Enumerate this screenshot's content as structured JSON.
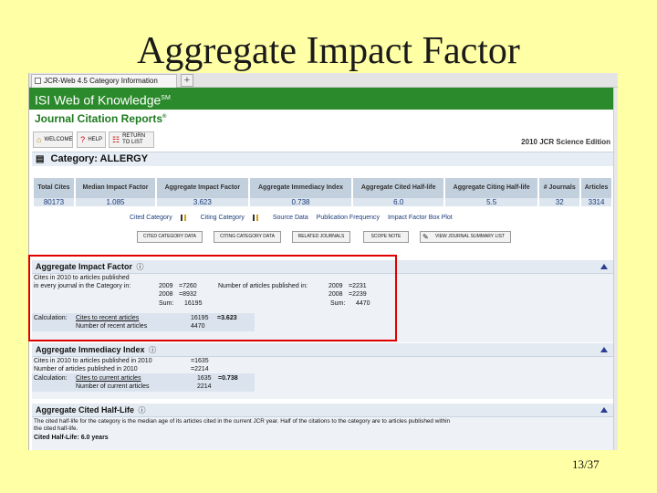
{
  "slide": {
    "title": "Aggregate Impact Factor",
    "page_number": "13/37"
  },
  "browser": {
    "tab_label": "JCR-Web 4.5 Category Information",
    "new_tab": "+"
  },
  "header": {
    "wok_title": "ISI Web of Knowledge",
    "wok_sup": "SM",
    "jcr_title": "Journal Citation Reports",
    "jcr_sup": "®",
    "edition": "2010 JCR Science Edition",
    "buttons": [
      "WELCOME",
      "HELP",
      "RETURN TO LIST"
    ]
  },
  "category": {
    "label": "Category:",
    "name": "ALLERGY"
  },
  "stats_table": {
    "headers": [
      "Total Cites",
      "Median Impact Factor",
      "Aggregate Impact Factor",
      "Aggregate Immediacy Index",
      "Aggregate Cited Half-life",
      "Aggregate Citing Half-life",
      "# Journals",
      "Articles"
    ],
    "values": [
      "80173",
      "1.085",
      "3.623",
      "0.738",
      "6.0",
      "5.5",
      "32",
      "3314"
    ]
  },
  "links": [
    "Cited Category",
    "Citing Category",
    "Source Data",
    "Publication Frequency",
    "Impact Factor Box Plot"
  ],
  "action_buttons": [
    "CITED CATEGORY DATA",
    "CITING CATEGORY DATA",
    "RELATED JOURNALS",
    "SCOPE NOTE",
    "VIEW JOURNAL SUMMARY LIST"
  ],
  "impact_factor": {
    "heading": "Aggregate Impact Factor",
    "line1": "Cites in 2010 to articles published",
    "line2": "in every journal in the Category in:",
    "cites": [
      {
        "year": "2009",
        "value": "=7260"
      },
      {
        "year": "2008",
        "value": "=8932"
      }
    ],
    "cites_sum_label": "Sum:",
    "cites_sum": "16195",
    "articles_label": "Number of articles published in:",
    "articles": [
      {
        "year": "2009",
        "value": "=2231"
      },
      {
        "year": "2008",
        "value": "=2239"
      }
    ],
    "articles_sum_label": "Sum:",
    "articles_sum": "4470",
    "calc_label": "Calculation:",
    "calc_numerator_label": "Cites to recent articles",
    "calc_numerator": "16195",
    "calc_result": "=3.623",
    "calc_denominator_label": "Number of recent articles",
    "calc_denominator": "4470"
  },
  "immediacy": {
    "heading": "Aggregate Immediacy Index",
    "line1_label": "Cites in 2010 to articles published in 2010",
    "line1_value": "=1635",
    "line2_label": "Number of articles published in 2010",
    "line2_value": "=2214",
    "calc_label": "Calculation:",
    "calc_numerator_label": "Cites to current articles",
    "calc_numerator": "1635",
    "calc_result": "=0.738",
    "calc_denominator_label": "Number of current articles",
    "calc_denominator": "2214"
  },
  "half_life": {
    "heading": "Aggregate Cited Half-Life",
    "text1": "The cited half-life for the category is the median age of its articles cited in the current JCR year. Half of the citations to the category are to articles published within",
    "text2": "the cited half-life.",
    "result": "Cited Half-Life: 6.0 years"
  },
  "icons": {
    "info": "info-icon",
    "collapse": "collapse-triangle-icon",
    "chart": "bar-chart-icon"
  },
  "colors": {
    "slide_bg": "#ffffa6",
    "wok_green": "#2b8a2b",
    "highlight_red": "#e00000",
    "link_blue": "#1a3a7a"
  }
}
